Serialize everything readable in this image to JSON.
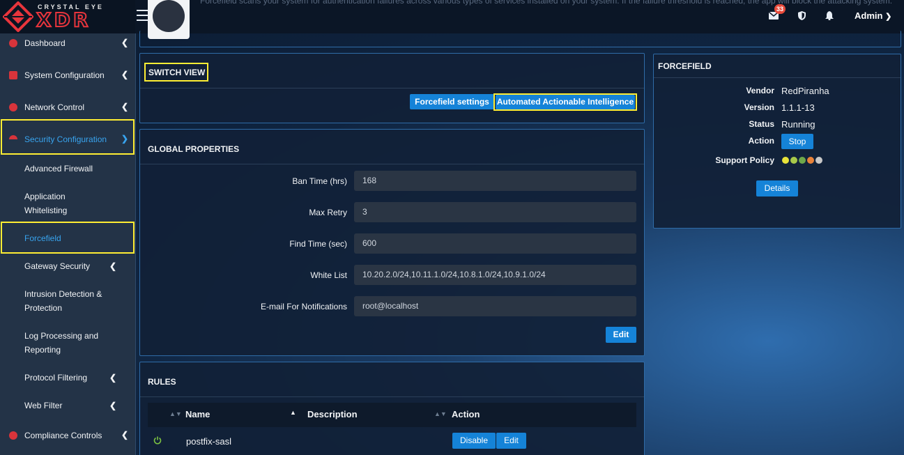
{
  "brand": {
    "name_small": "CRYSTAL EYE",
    "name_big": "XDR"
  },
  "header": {
    "description": "Forcefield scans your system for authentication failures across various types of services installed on your system. If the failure threshold is reached, the app will block the attacking system.",
    "mail_count": "33",
    "user_label": "Admin"
  },
  "sidebar": {
    "items": [
      {
        "label": "Dashboard"
      },
      {
        "label": "System Configuration"
      },
      {
        "label": "Network Control"
      },
      {
        "label": "Security Configuration"
      },
      {
        "label": "Compliance Controls"
      }
    ],
    "sub_items": [
      {
        "label": "Advanced Firewall"
      },
      {
        "label": "Application"
      },
      {
        "label": "Whitelisting"
      },
      {
        "label": "Forcefield"
      },
      {
        "label": "Gateway Security"
      },
      {
        "label": "Intrusion Detection &"
      },
      {
        "label": "Protection"
      },
      {
        "label": "Log Processing and"
      },
      {
        "label": "Reporting"
      },
      {
        "label": "Protocol Filtering"
      },
      {
        "label": "Web Filter"
      }
    ]
  },
  "switch_view": {
    "title": "SWITCH VIEW",
    "btn_settings": "Forcefield settings",
    "btn_aai": "Automated Actionable Intelligence"
  },
  "global_properties": {
    "title": "GLOBAL PROPERTIES",
    "fields": [
      {
        "label": "Ban Time (hrs)",
        "value": "168"
      },
      {
        "label": "Max Retry",
        "value": "3"
      },
      {
        "label": "Find Time (sec)",
        "value": "600"
      },
      {
        "label": "White List",
        "value": "10.20.2.0/24,10.11.1.0/24,10.8.1.0/24,10.9.1.0/24"
      },
      {
        "label": "E-mail For Notifications",
        "value": "root@localhost"
      }
    ],
    "edit_label": "Edit"
  },
  "rules": {
    "title": "RULES",
    "columns": [
      "Name",
      "Description",
      "Action"
    ],
    "rows": [
      {
        "name": "postfix-sasl",
        "description": "",
        "disable_label": "Disable",
        "edit_label": "Edit"
      }
    ]
  },
  "forcefield_panel": {
    "title": "FORCEFIELD",
    "vendor_label": "Vendor",
    "vendor": "RedPiranha",
    "version_label": "Version",
    "version": "1.1.1-13",
    "status_label": "Status",
    "status": "Running",
    "action_label": "Action",
    "action_button": "Stop",
    "support_label": "Support Policy",
    "support_dots": [
      "#e8e33a",
      "#a8c94a",
      "#6fa84a",
      "#e8833a",
      "#c8c8c8"
    ],
    "details_label": "Details"
  },
  "colors": {
    "accent": "#1583d8",
    "highlight": "#ffee33",
    "brand_red": "#e8353c"
  }
}
